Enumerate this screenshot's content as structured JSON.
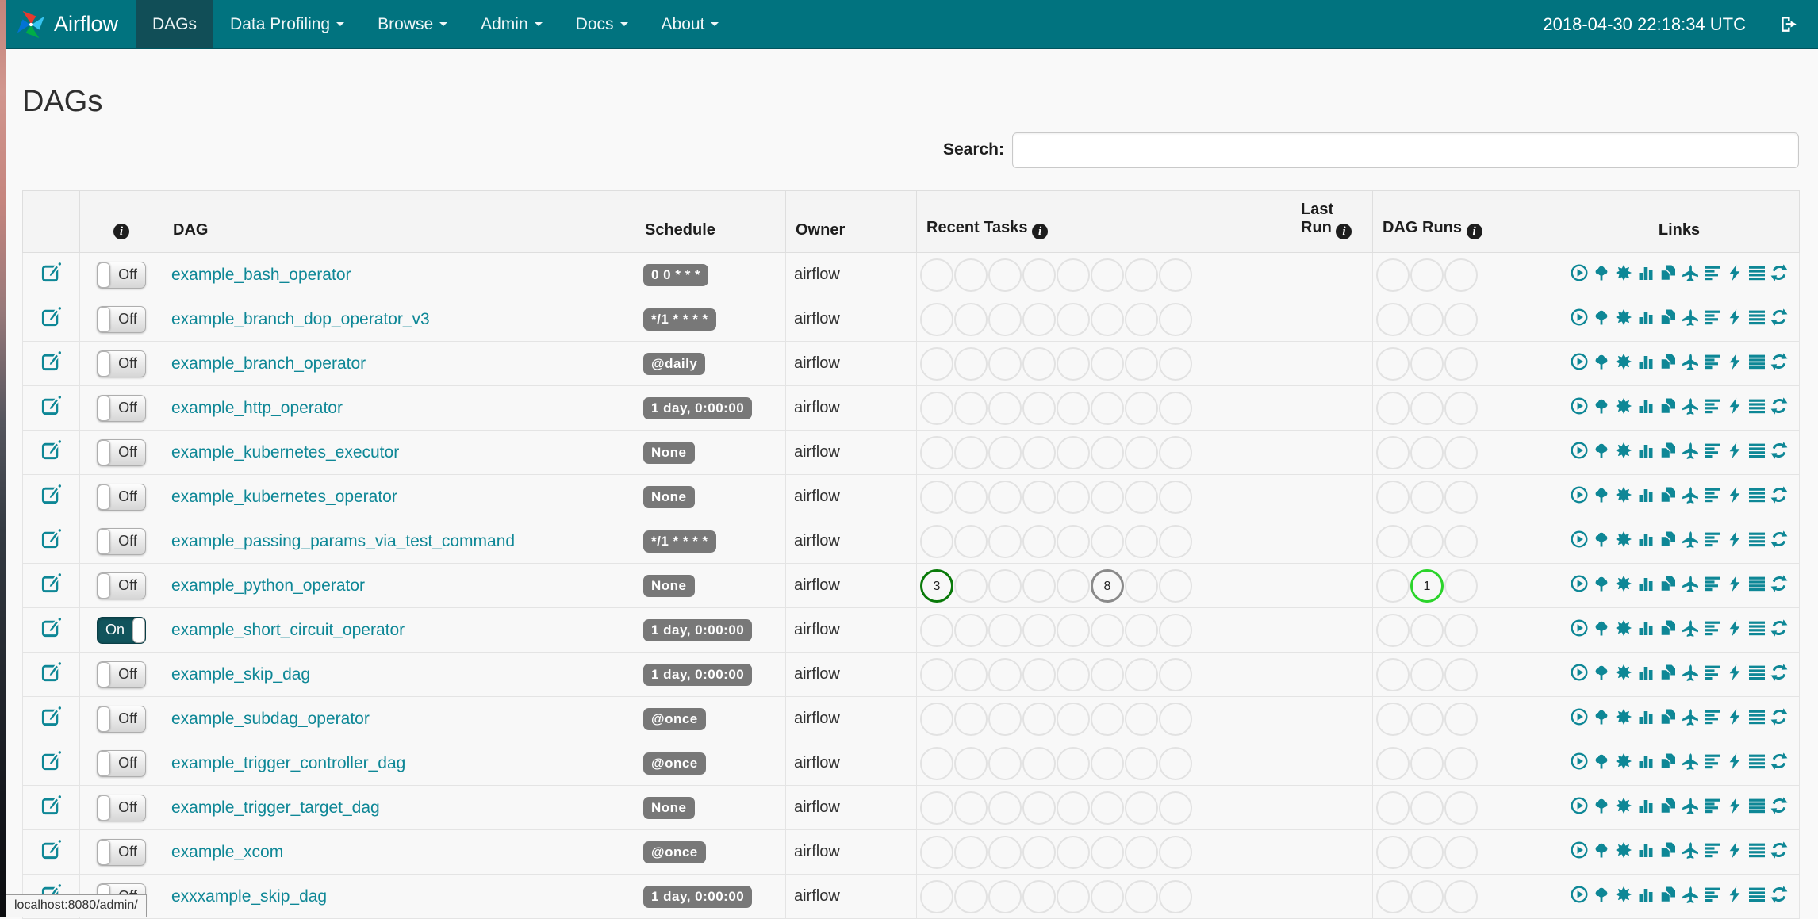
{
  "navbar": {
    "brand": "Airflow",
    "items": [
      {
        "label": "DAGs",
        "active": true,
        "caret": false
      },
      {
        "label": "Data Profiling",
        "active": false,
        "caret": true
      },
      {
        "label": "Browse",
        "active": false,
        "caret": true
      },
      {
        "label": "Admin",
        "active": false,
        "caret": true
      },
      {
        "label": "Docs",
        "active": false,
        "caret": true
      },
      {
        "label": "About",
        "active": false,
        "caret": true
      }
    ],
    "clock": "2018-04-30 22:18:34 UTC"
  },
  "page": {
    "title": "DAGs",
    "search_label": "Search:",
    "search_value": "",
    "status_bar": "localhost:8080/admin/"
  },
  "icons": {
    "info_glyph": "i"
  },
  "colors": {
    "navbar": "#01737f",
    "navbar_active": "#114e57",
    "link_teal": "#0e8796",
    "badge_gray": "#787878",
    "circle_default": "#e2e2e2",
    "circle_success": "#0a7a0a",
    "circle_gray": "#8a8a8a",
    "circle_running": "#2bd42b"
  },
  "table": {
    "headers": {
      "dag": "DAG",
      "schedule": "Schedule",
      "owner": "Owner",
      "recent_tasks": "Recent Tasks",
      "last_run": "Last Run",
      "dag_runs": "DAG Runs",
      "links": "Links"
    },
    "recent_task_slots": 8,
    "dag_run_slots": 3,
    "links": [
      "trigger-dag-icon",
      "tree-view-icon",
      "graph-view-icon",
      "task-duration-icon",
      "task-tries-icon",
      "landing-times-icon",
      "gantt-view-icon",
      "code-view-icon",
      "logs-icon",
      "refresh-icon"
    ],
    "rows": [
      {
        "name": "example_bash_operator",
        "toggle": "Off",
        "schedule": "0 0 * * *",
        "owner": "airflow",
        "recent_tasks": {},
        "dag_runs": {}
      },
      {
        "name": "example_branch_dop_operator_v3",
        "toggle": "Off",
        "schedule": "*/1 * * * *",
        "owner": "airflow",
        "recent_tasks": {},
        "dag_runs": {}
      },
      {
        "name": "example_branch_operator",
        "toggle": "Off",
        "schedule": "@daily",
        "owner": "airflow",
        "recent_tasks": {},
        "dag_runs": {}
      },
      {
        "name": "example_http_operator",
        "toggle": "Off",
        "schedule": "1 day, 0:00:00",
        "owner": "airflow",
        "recent_tasks": {},
        "dag_runs": {}
      },
      {
        "name": "example_kubernetes_executor",
        "toggle": "Off",
        "schedule": "None",
        "owner": "airflow",
        "recent_tasks": {},
        "dag_runs": {}
      },
      {
        "name": "example_kubernetes_operator",
        "toggle": "Off",
        "schedule": "None",
        "owner": "airflow",
        "recent_tasks": {},
        "dag_runs": {}
      },
      {
        "name": "example_passing_params_via_test_command",
        "toggle": "Off",
        "schedule": "*/1 * * * *",
        "owner": "airflow",
        "recent_tasks": {},
        "dag_runs": {}
      },
      {
        "name": "example_python_operator",
        "toggle": "Off",
        "schedule": "None",
        "owner": "airflow",
        "recent_tasks": {
          "0": {
            "count": "3",
            "color": "#0a7a0a"
          },
          "5": {
            "count": "8",
            "color": "#8a8a8a"
          }
        },
        "dag_runs": {
          "1": {
            "count": "1",
            "color": "#2bd42b"
          }
        }
      },
      {
        "name": "example_short_circuit_operator",
        "toggle": "On",
        "schedule": "1 day, 0:00:00",
        "owner": "airflow",
        "recent_tasks": {},
        "dag_runs": {}
      },
      {
        "name": "example_skip_dag",
        "toggle": "Off",
        "schedule": "1 day, 0:00:00",
        "owner": "airflow",
        "recent_tasks": {},
        "dag_runs": {}
      },
      {
        "name": "example_subdag_operator",
        "toggle": "Off",
        "schedule": "@once",
        "owner": "airflow",
        "recent_tasks": {},
        "dag_runs": {}
      },
      {
        "name": "example_trigger_controller_dag",
        "toggle": "Off",
        "schedule": "@once",
        "owner": "airflow",
        "recent_tasks": {},
        "dag_runs": {}
      },
      {
        "name": "example_trigger_target_dag",
        "toggle": "Off",
        "schedule": "None",
        "owner": "airflow",
        "recent_tasks": {},
        "dag_runs": {}
      },
      {
        "name": "example_xcom",
        "toggle": "Off",
        "schedule": "@once",
        "owner": "airflow",
        "recent_tasks": {},
        "dag_runs": {}
      },
      {
        "name": "exxxample_skip_dag",
        "toggle": "Off",
        "schedule": "1 day, 0:00:00",
        "owner": "airflow",
        "recent_tasks": {},
        "dag_runs": {}
      }
    ]
  }
}
